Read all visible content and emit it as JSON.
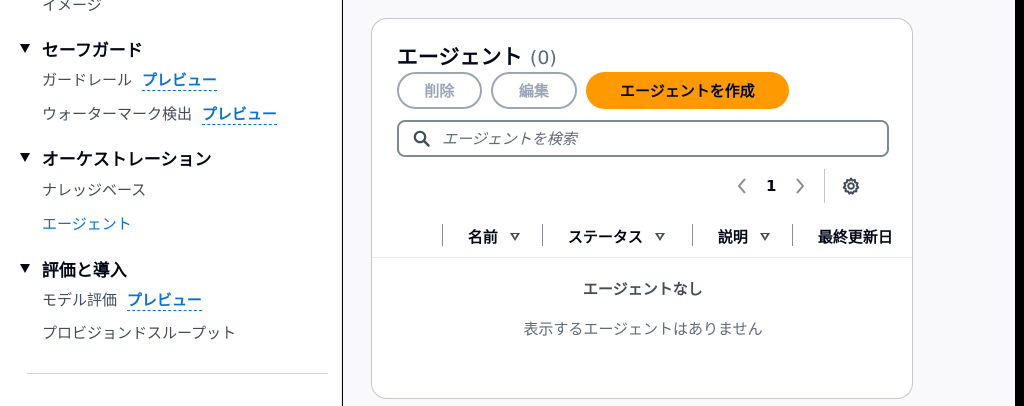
{
  "sidebar": {
    "top_item": "イメージ",
    "sections": [
      {
        "label": "セーフガード",
        "items": [
          {
            "label": "ガードレール",
            "badge": "プレビュー"
          },
          {
            "label": "ウォーターマーク検出",
            "badge": "プレビュー"
          }
        ]
      },
      {
        "label": "オーケストレーション",
        "items": [
          {
            "label": "ナレッジベース"
          },
          {
            "label": "エージェント",
            "active": true
          }
        ]
      },
      {
        "label": "評価と導入",
        "items": [
          {
            "label": "モデル評価",
            "badge": "プレビュー"
          },
          {
            "label": "プロビジョンドスループット"
          }
        ]
      }
    ]
  },
  "panel": {
    "title": "エージェント",
    "count": "(0)",
    "buttons": {
      "delete": "削除",
      "edit": "編集",
      "create": "エージェントを作成"
    },
    "search": {
      "placeholder": "エージェントを検索",
      "icon": "search-icon"
    },
    "pagination": {
      "current_page": "1"
    },
    "columns": [
      "名前",
      "ステータス",
      "説明",
      "最終更新日"
    ],
    "empty": {
      "title": "エージェントなし",
      "description": "表示するエージェントはありません"
    }
  },
  "colors": {
    "primary_button": "#ff9900",
    "link": "#0972d3",
    "text": "#000716"
  }
}
